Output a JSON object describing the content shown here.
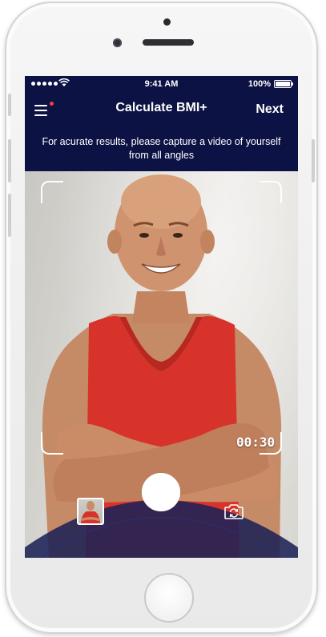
{
  "status_bar": {
    "time": "9:41 AM",
    "battery": "100%"
  },
  "nav": {
    "title": "Calculate BMI+",
    "next_label": "Next"
  },
  "instruction": "For acurate results, please capture a video of yourself from all angles",
  "camera": {
    "timer": "00:30"
  },
  "colors": {
    "header_bg": "#0d1244",
    "arc_bg": "#1c2256",
    "menu_badge": "#ff3b3b",
    "tank_top": "#d8332a"
  },
  "icons": {
    "menu": "hamburger-menu-icon",
    "shutter": "record-button",
    "gallery": "gallery-thumbnail",
    "flip": "camera-flip-icon"
  }
}
